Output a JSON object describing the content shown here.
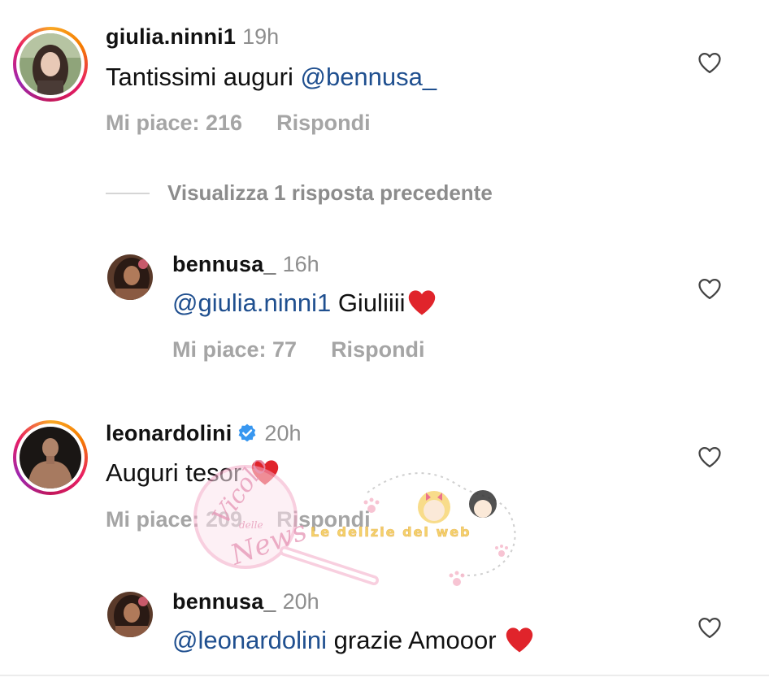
{
  "comments": [
    {
      "username": "giulia.ninni1",
      "time": "19h",
      "text_prefix": "Tantissimi auguri ",
      "mention": "@bennusa_",
      "likes": "Mi piace: 216",
      "reply": "Rispondi"
    },
    {
      "username": "leonardolini",
      "time": "20h",
      "text": "Auguri tesor",
      "emoji": "❤️",
      "likes": "Mi piace: 209",
      "reply": "Rispondi"
    }
  ],
  "view_previous": "Visualizza 1 risposta precedente",
  "replies": [
    {
      "username": "bennusa_",
      "time": "16h",
      "mention": "@giulia.ninni1",
      "text": " Giuliiii",
      "emoji": "❤️",
      "likes": "Mi piace: 77",
      "reply": "Rispondi"
    },
    {
      "username": "bennusa_",
      "time": "20h",
      "mention": "@leonardolini",
      "text": " grazie Amooor ",
      "emoji": "❤️"
    }
  ],
  "watermark": {
    "line1": "Vicolo",
    "line2": "delle",
    "line3": "News",
    "tagline": "Le delizie del web"
  },
  "colors": {
    "mention": "#1f4f8f",
    "meta_gray": "#a5a5a5",
    "heart_red": "#e0242b",
    "verified_blue": "#3897f0"
  }
}
